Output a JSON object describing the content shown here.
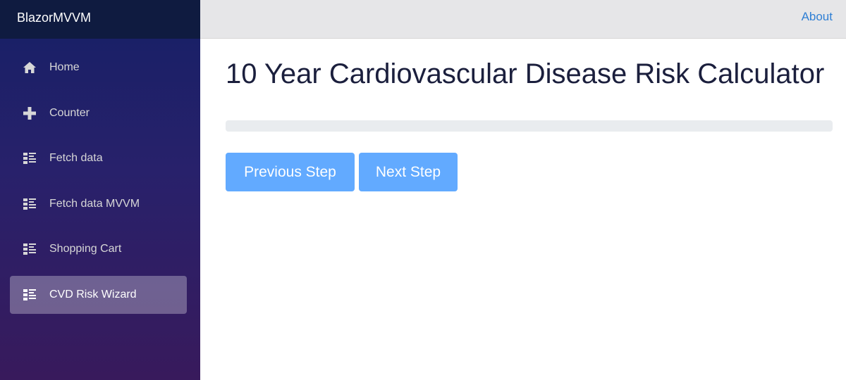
{
  "app": {
    "brand": "BlazorMVVM"
  },
  "topbar": {
    "about_label": "About"
  },
  "sidebar": {
    "items": [
      {
        "label": "Home",
        "icon": "home-icon",
        "active": false
      },
      {
        "label": "Counter",
        "icon": "plus-icon",
        "active": false
      },
      {
        "label": "Fetch data",
        "icon": "list-icon",
        "active": false
      },
      {
        "label": "Fetch data MVVM",
        "icon": "list-icon",
        "active": false
      },
      {
        "label": "Shopping Cart",
        "icon": "list-icon",
        "active": false
      },
      {
        "label": "CVD Risk Wizard",
        "icon": "list-icon",
        "active": true
      }
    ]
  },
  "main": {
    "title": "10 Year Cardiovascular Disease Risk Calculator",
    "progress_percent": 0,
    "prev_label": "Previous Step",
    "next_label": "Next Step"
  },
  "colors": {
    "button": "#62aaff",
    "link": "#2f7fd4",
    "sidebar_top": "#162066",
    "sidebar_bottom": "#381a5c"
  }
}
